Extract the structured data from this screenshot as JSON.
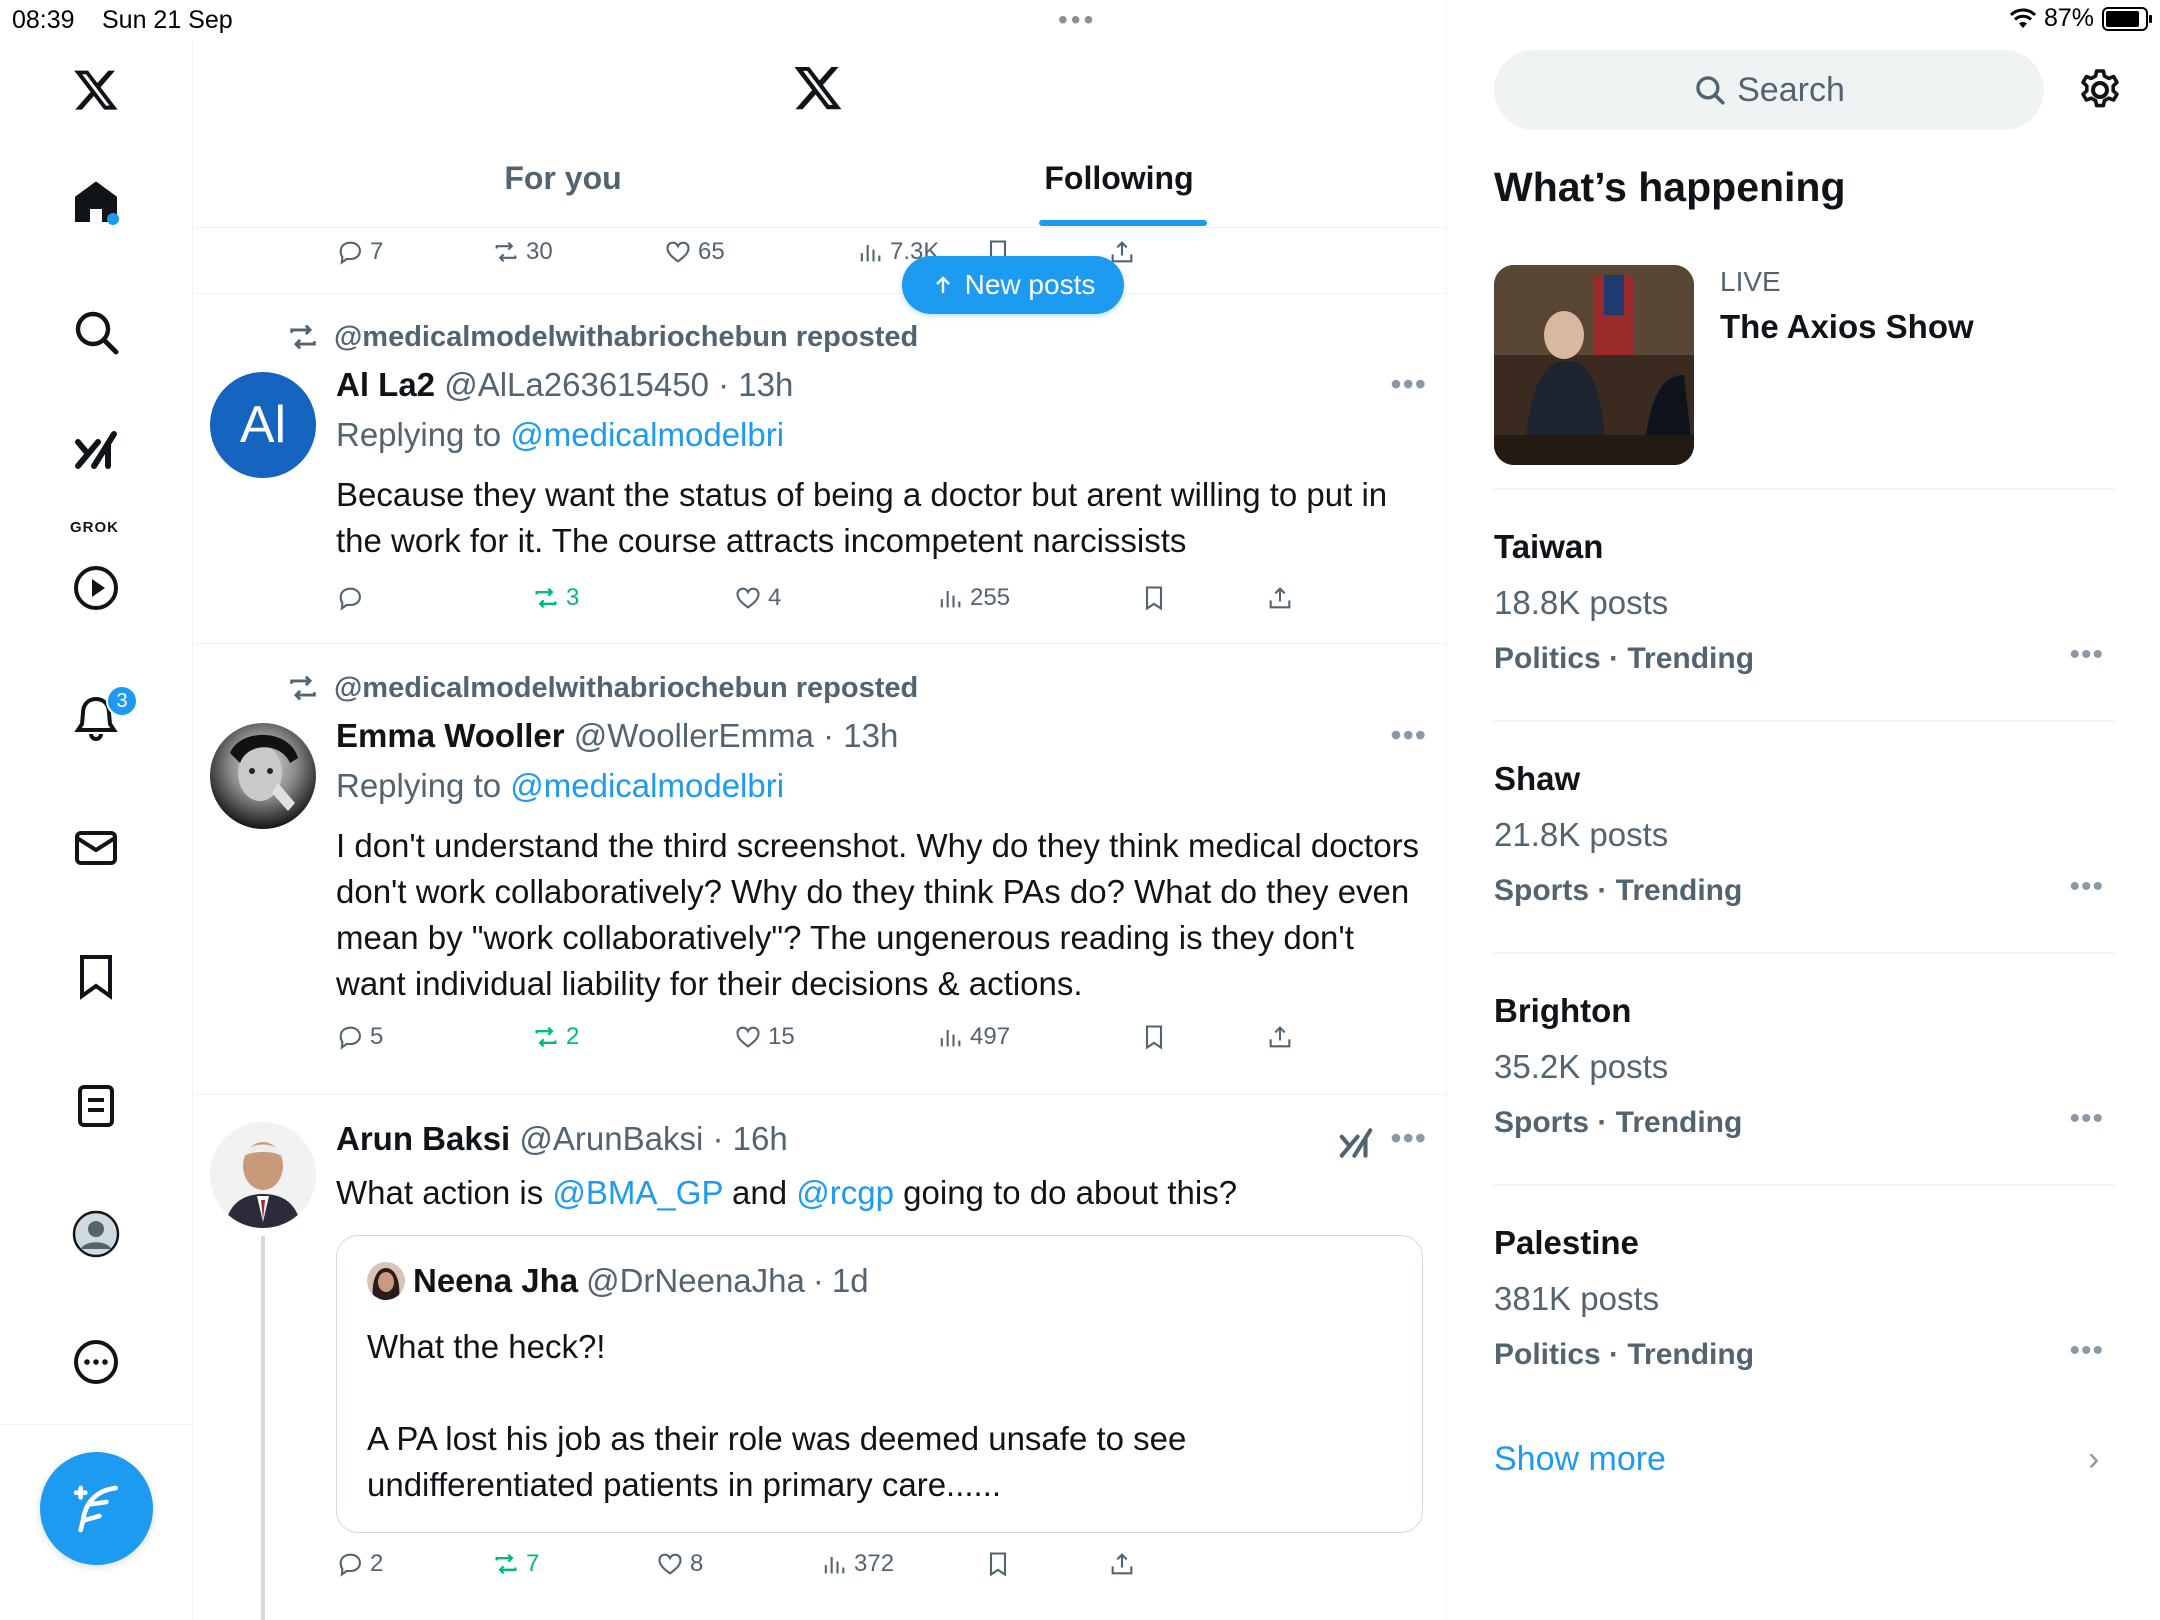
{
  "status_bar": {
    "time": "08:39",
    "date": "Sun 21 Sep",
    "dots": "•••",
    "battery": "87%",
    "battery_level": 0.87
  },
  "nav": {
    "notifications_badge": "3",
    "grok_label": "GROK"
  },
  "header": {
    "tabs": [
      {
        "label": "For you",
        "selected": false
      },
      {
        "label": "Following",
        "selected": true
      }
    ]
  },
  "new_posts": {
    "label": "New posts"
  },
  "top_actions": {
    "replies": "7",
    "reposts": "30",
    "likes": "65",
    "views": "7.3K"
  },
  "posts": [
    {
      "repost_by": "@medicalmodelwithabriochebun reposted",
      "avatar_text": "Al",
      "name": "Al La2",
      "handle": "@AlLa263615450",
      "time": "13h",
      "replying_prefix": "Replying to",
      "replying_to": "@medicalmodelbri",
      "text": "Because they want the status of being a doctor but arent willing to put in the work for it. The course attracts incompetent narcissists",
      "replies": "",
      "reposts": "3",
      "likes": "4",
      "views": "255"
    },
    {
      "repost_by": "@medicalmodelwithabriochebun reposted",
      "name": "Emma Wooller",
      "handle": "@WoollerEmma",
      "time": "13h",
      "replying_prefix": "Replying to",
      "replying_to": "@medicalmodelbri",
      "text": "I don't understand the third screenshot. Why do they think medical doctors don't work collaboratively? Why do they think PAs do? What do they even mean by \"work collaboratively\"? The ungenerous reading is they don't want individual liability for their decisions & actions.",
      "replies": "5",
      "reposts": "2",
      "likes": "15",
      "views": "497"
    },
    {
      "name": "Arun Baksi",
      "handle": "@ArunBaksi",
      "time": "16h",
      "text_parts": {
        "a": "What action is ",
        "mention1": "@BMA_GP",
        "b": " and ",
        "mention2": "@rcgp",
        "c": " going to do about this?"
      },
      "quote": {
        "name": "Neena Jha",
        "handle": "@DrNeenaJha",
        "time": "1d",
        "line1": "What the heck?!",
        "line2": "A PA lost his job as their role was deemed unsafe to see undifferentiated patients in primary care......"
      },
      "replies": "2",
      "reposts": "7",
      "likes": "8",
      "views": "372"
    }
  ],
  "right": {
    "search_placeholder": "Search",
    "whats_happening": "What’s happening",
    "live": {
      "label": "LIVE",
      "title": "The Axios Show"
    },
    "trends": [
      {
        "name": "Taiwan",
        "count": "18.8K posts",
        "category": "Politics · Trending"
      },
      {
        "name": "Shaw",
        "count": "21.8K posts",
        "category": "Sports · Trending"
      },
      {
        "name": "Brighton",
        "count": "35.2K posts",
        "category": "Sports · Trending"
      },
      {
        "name": "Palestine",
        "count": "381K posts",
        "category": "Politics · Trending"
      }
    ],
    "show_more": "Show more",
    "more_glyph": "•••",
    "chevron": "›"
  },
  "colors": {
    "accent": "#1d9bf0",
    "repost_green": "#00ba7c",
    "muted": "#536471"
  }
}
